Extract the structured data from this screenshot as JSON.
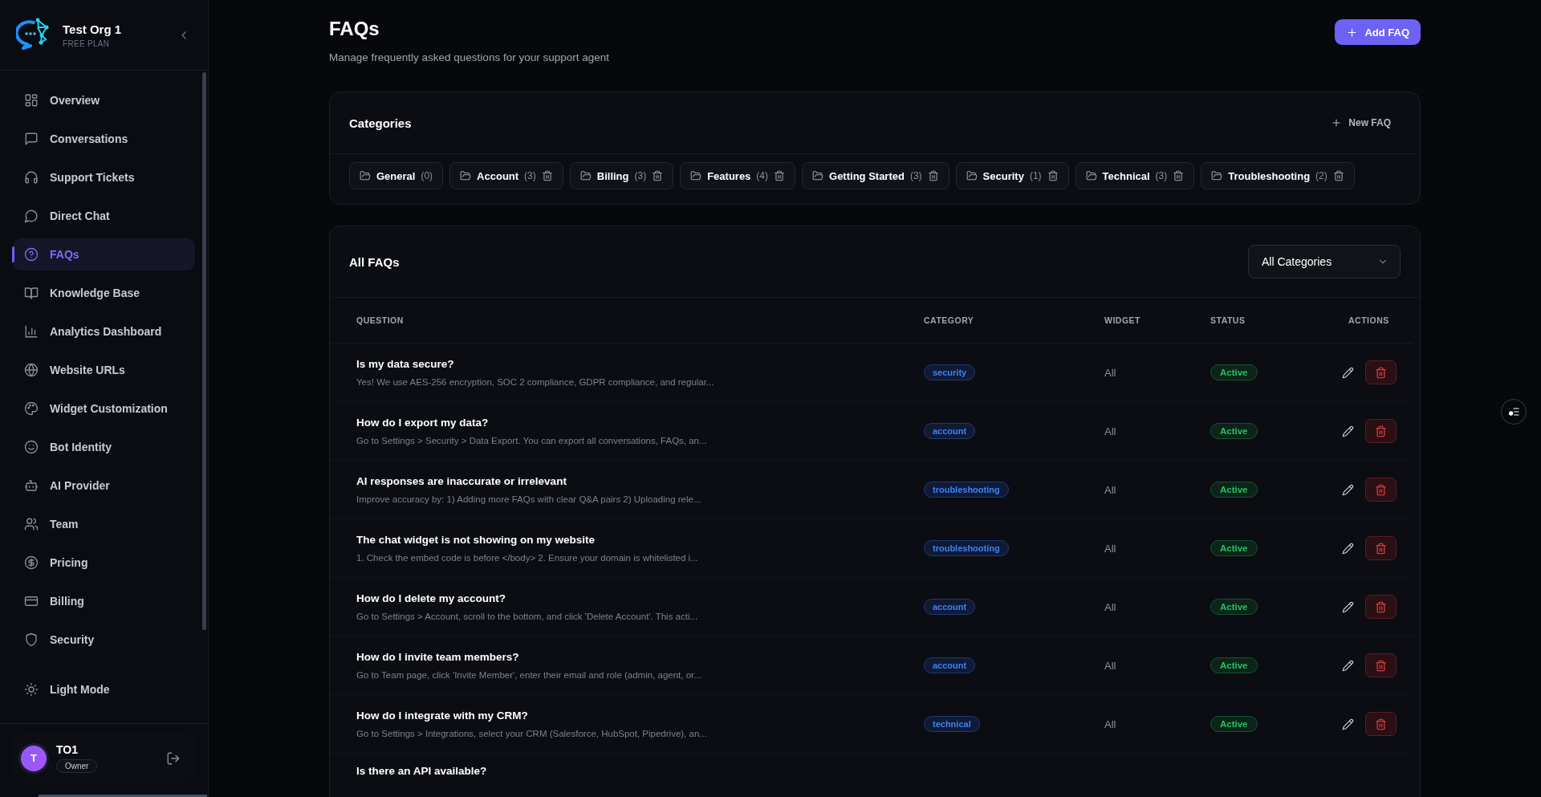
{
  "sidebar": {
    "org": {
      "name": "Test Org 1",
      "plan": "FREE PLAN"
    },
    "items": [
      {
        "label": "Overview",
        "selected": false
      },
      {
        "label": "Conversations",
        "selected": false
      },
      {
        "label": "Support Tickets",
        "selected": false
      },
      {
        "label": "Direct Chat",
        "selected": false
      },
      {
        "label": "FAQs",
        "selected": true
      },
      {
        "label": "Knowledge Base",
        "selected": false
      },
      {
        "label": "Analytics Dashboard",
        "selected": false
      },
      {
        "label": "Website URLs",
        "selected": false
      },
      {
        "label": "Widget Customization",
        "selected": false
      },
      {
        "label": "Bot Identity",
        "selected": false
      },
      {
        "label": "AI Provider",
        "selected": false
      },
      {
        "label": "Team",
        "selected": false
      },
      {
        "label": "Pricing",
        "selected": false
      },
      {
        "label": "Billing",
        "selected": false
      },
      {
        "label": "Security",
        "selected": false
      }
    ],
    "theme_toggle": "Light Mode",
    "user": {
      "initial": "T",
      "name": "TO1",
      "role": "Owner"
    }
  },
  "header": {
    "title": "FAQs",
    "subtitle": "Manage frequently asked questions for your support agent",
    "add_button": "Add FAQ"
  },
  "categories": {
    "title": "Categories",
    "new_button": "New FAQ",
    "items": [
      {
        "name": "General",
        "count": "(0)",
        "deletable": false
      },
      {
        "name": "Account",
        "count": "(3)",
        "deletable": true
      },
      {
        "name": "Billing",
        "count": "(3)",
        "deletable": true
      },
      {
        "name": "Features",
        "count": "(4)",
        "deletable": true
      },
      {
        "name": "Getting Started",
        "count": "(3)",
        "deletable": true
      },
      {
        "name": "Security",
        "count": "(1)",
        "deletable": true
      },
      {
        "name": "Technical",
        "count": "(3)",
        "deletable": true
      },
      {
        "name": "Troubleshooting",
        "count": "(2)",
        "deletable": true
      }
    ]
  },
  "faqs": {
    "title": "All FAQs",
    "filter": "All Categories",
    "columns": [
      "QUESTION",
      "CATEGORY",
      "WIDGET",
      "STATUS",
      "ACTIONS"
    ],
    "rows": [
      {
        "question": "Is my data secure?",
        "answer": "Yes! We use AES-256 encryption, SOC 2 compliance, GDPR compliance, and regular...",
        "category": "security",
        "widget": "All",
        "status": "Active"
      },
      {
        "question": "How do I export my data?",
        "answer": "Go to Settings > Security > Data Export. You can export all conversations, FAQs, an...",
        "category": "account",
        "widget": "All",
        "status": "Active"
      },
      {
        "question": "AI responses are inaccurate or irrelevant",
        "answer": "Improve accuracy by: 1) Adding more FAQs with clear Q&A pairs 2) Uploading rele...",
        "category": "troubleshooting",
        "widget": "All",
        "status": "Active"
      },
      {
        "question": "The chat widget is not showing on my website",
        "answer": "1. Check the embed code is before </body> 2. Ensure your domain is whitelisted i...",
        "category": "troubleshooting",
        "widget": "All",
        "status": "Active"
      },
      {
        "question": "How do I delete my account?",
        "answer": "Go to Settings > Account, scroll to the bottom, and click 'Delete Account'. This acti...",
        "category": "account",
        "widget": "All",
        "status": "Active"
      },
      {
        "question": "How do I invite team members?",
        "answer": "Go to Team page, click 'Invite Member', enter their email and role (admin, agent, or...",
        "category": "account",
        "widget": "All",
        "status": "Active"
      },
      {
        "question": "How do I integrate with my CRM?",
        "answer": "Go to Settings > Integrations, select your CRM (Salesforce, HubSpot, Pipedrive), an...",
        "category": "technical",
        "widget": "All",
        "status": "Active"
      },
      {
        "question": "Is there an API available?"
      }
    ]
  }
}
